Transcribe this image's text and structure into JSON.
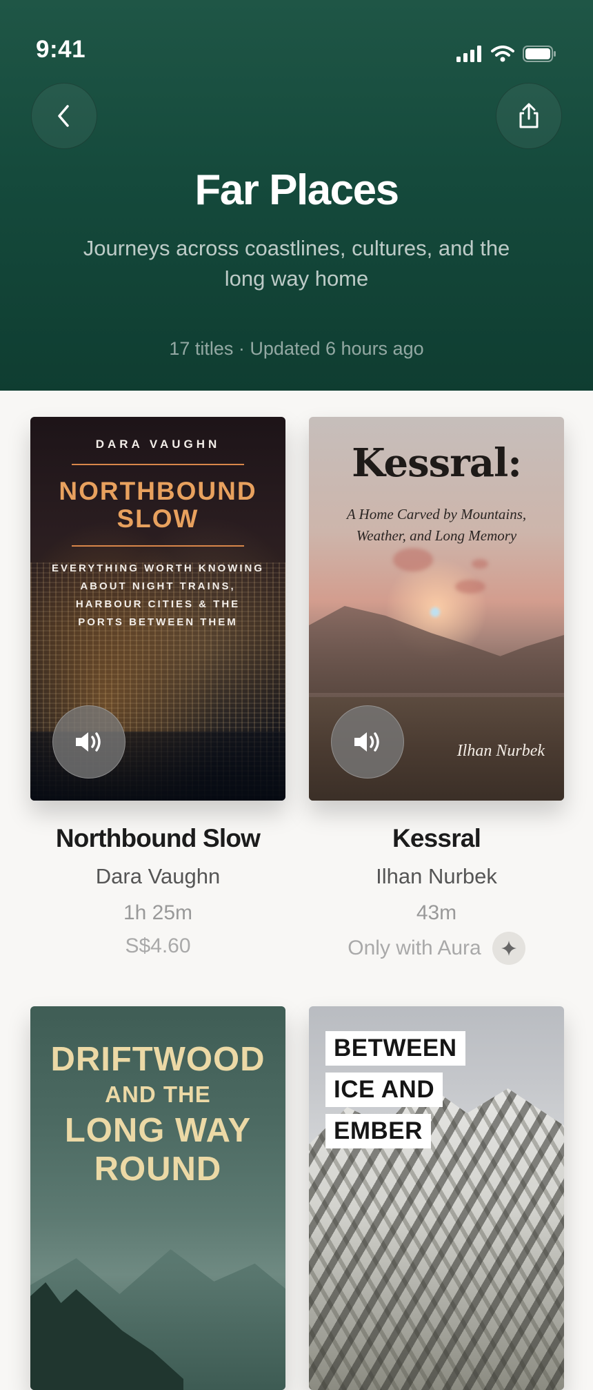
{
  "status_bar": {
    "time": "9:41"
  },
  "header": {
    "title": "Far Places",
    "subtitle": "Journeys across coastlines, cultures, and the long way home",
    "meta": "17 titles · Updated 6 hours ago"
  },
  "books": [
    {
      "title": "Northbound Slow",
      "author": "Dara Vaughn",
      "duration": "1h 25m",
      "price": "S$4.60",
      "cover": {
        "author": "DARA VAUGHN",
        "title_line1": "NORTHBOUND",
        "title_line2": "SLOW",
        "tagline": "EVERYTHING WORTH KNOWING ABOUT NIGHT TRAINS, HARBOUR CITIES & THE PORTS BETWEEN THEM"
      }
    },
    {
      "title": "Kessral",
      "author": "Ilhan Nurbek",
      "duration": "43m",
      "availability": "Only with Aura",
      "cover": {
        "title": "Kessral:",
        "subtitle": "A Home Carved by Mountains, Weather, and Long Memory",
        "author": "Ilhan Nurbek"
      }
    },
    {
      "cover": {
        "line1": "DRIFTWOOD",
        "line2": "AND THE",
        "line3": "LONG WAY",
        "line4": "ROUND"
      }
    },
    {
      "cover": {
        "line1": "BETWEEN",
        "line2": "ICE AND",
        "line3": "EMBER"
      }
    }
  ],
  "colors": {
    "header_green": "#154a3c",
    "accent_orange": "#e8a15e",
    "cream_title": "#ecd9a6"
  },
  "icons": {
    "back": "chevron-left-icon",
    "share": "share-icon",
    "audio": "speaker-icon",
    "aura": "sparkle-icon"
  }
}
